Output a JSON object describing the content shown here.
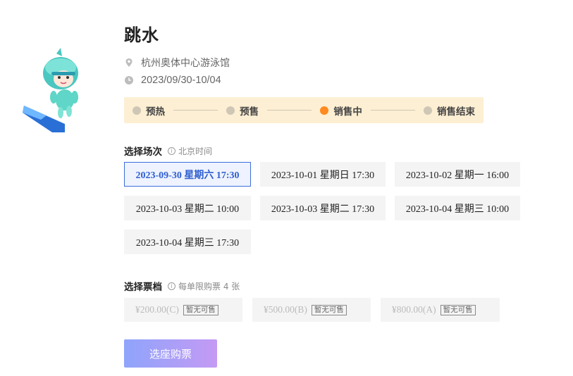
{
  "event": {
    "title": "跳水",
    "venue": "杭州奥体中心游泳馆",
    "date_range": "2023/09/30-10/04"
  },
  "progress": {
    "steps": [
      {
        "label": "预热",
        "active": false
      },
      {
        "label": "预售",
        "active": false
      },
      {
        "label": "销售中",
        "active": true
      },
      {
        "label": "销售结束",
        "active": false
      }
    ]
  },
  "sessions": {
    "label": "选择场次",
    "hint": "北京时间",
    "items": [
      {
        "label": "2023-09-30 星期六 17:30",
        "selected": true
      },
      {
        "label": "2023-10-01 星期日 17:30",
        "selected": false
      },
      {
        "label": "2023-10-02 星期一 16:00",
        "selected": false
      },
      {
        "label": "2023-10-03 星期二 10:00",
        "selected": false
      },
      {
        "label": "2023-10-03 星期二 17:30",
        "selected": false
      },
      {
        "label": "2023-10-04 星期三 10:00",
        "selected": false
      },
      {
        "label": "2023-10-04 星期三 17:30",
        "selected": false
      }
    ]
  },
  "tickets": {
    "label": "选择票档",
    "hint": "每单限购票 4 张",
    "items": [
      {
        "price": "¥200.00(C)",
        "status": "暂无可售"
      },
      {
        "price": "¥500.00(B)",
        "status": "暂无可售"
      },
      {
        "price": "¥800.00(A)",
        "status": "暂无可售"
      }
    ]
  },
  "actions": {
    "buy_label": "选座购票"
  },
  "colors": {
    "accent_blue": "#3d6fdb",
    "active_step": "#ff8a1f",
    "progress_bg": "#fdefd3",
    "button_gradient_start": "#8fa4fb",
    "button_gradient_end": "#c49af4"
  },
  "icons": {
    "venue": "location-pin-icon",
    "date": "clock-icon",
    "hint": "info-icon"
  }
}
